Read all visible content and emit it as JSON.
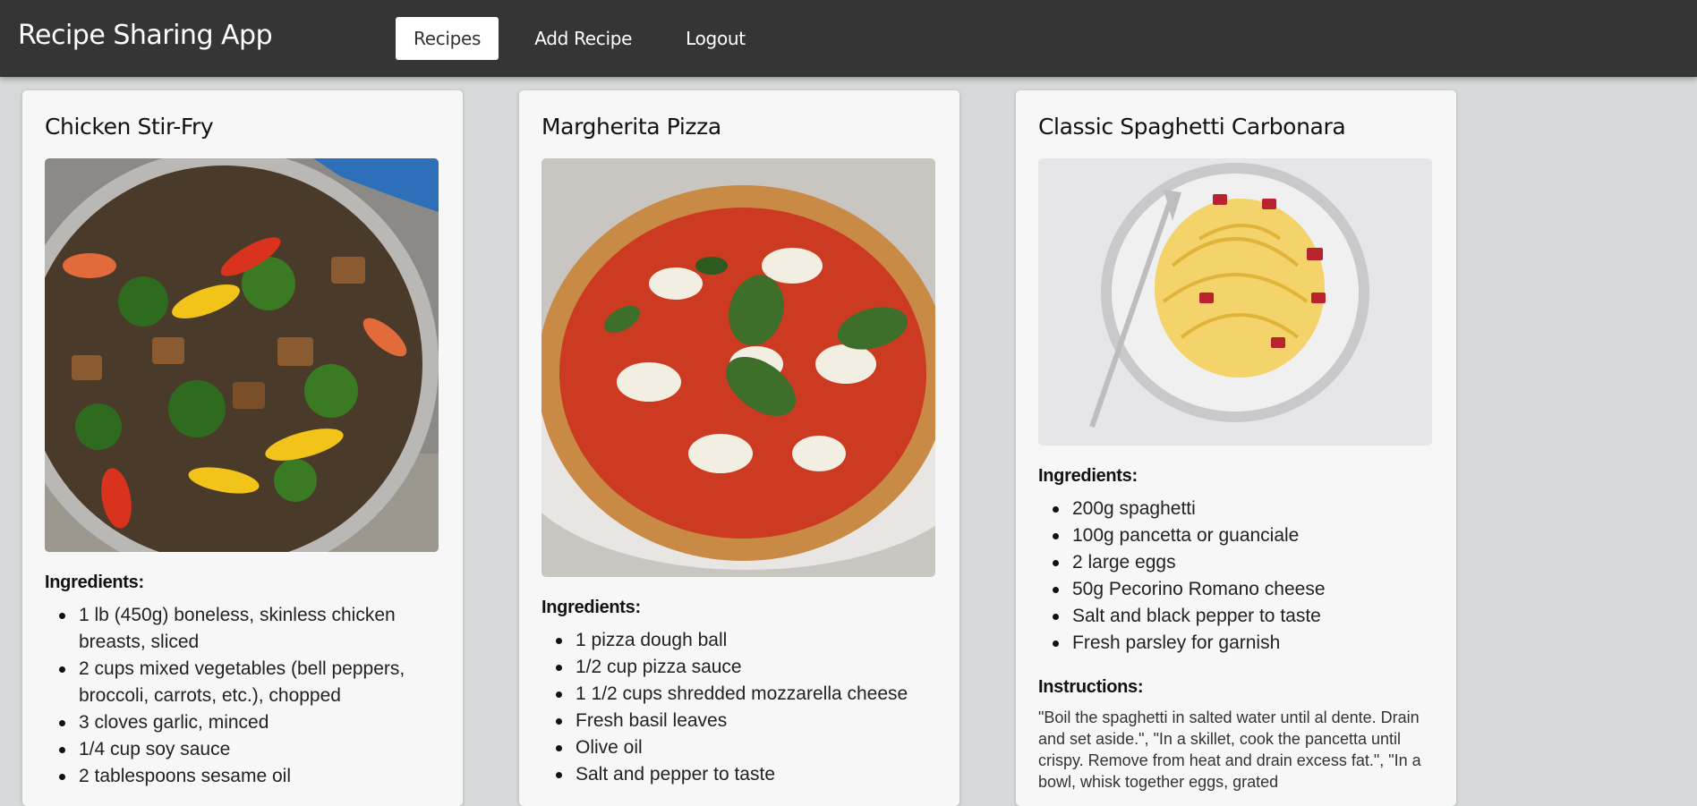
{
  "app": {
    "title": "Recipe Sharing App"
  },
  "nav": {
    "recipes": "Recipes",
    "add_recipe": "Add Recipe",
    "logout": "Logout"
  },
  "recipes": [
    {
      "title": "Chicken Stir-Fry",
      "ingredients_label": "Ingredients:",
      "ingredients": [
        "1 lb (450g) boneless, skinless chicken breasts, sliced",
        "2 cups mixed vegetables (bell peppers, broccoli, carrots, etc.), chopped",
        "3 cloves garlic, minced",
        "1/4 cup soy sauce",
        "2 tablespoons sesame oil"
      ]
    },
    {
      "title": "Margherita Pizza",
      "ingredients_label": "Ingredients:",
      "ingredients": [
        "1 pizza dough ball",
        "1/2 cup pizza sauce",
        "1 1/2 cups shredded mozzarella cheese",
        "Fresh basil leaves",
        "Olive oil",
        "Salt and pepper to taste"
      ]
    },
    {
      "title": "Classic Spaghetti Carbonara",
      "ingredients_label": "Ingredients:",
      "ingredients": [
        "200g spaghetti",
        "100g pancetta or guanciale",
        "2 large eggs",
        "50g Pecorino Romano cheese",
        "Salt and black pepper to taste",
        "Fresh parsley for garnish"
      ],
      "instructions_label": "Instructions:",
      "instructions": "\"Boil the spaghetti in salted water until al dente. Drain and set aside.\", \"In a skillet, cook the pancetta until crispy. Remove from heat and drain excess fat.\", \"In a bowl, whisk together eggs, grated"
    }
  ]
}
